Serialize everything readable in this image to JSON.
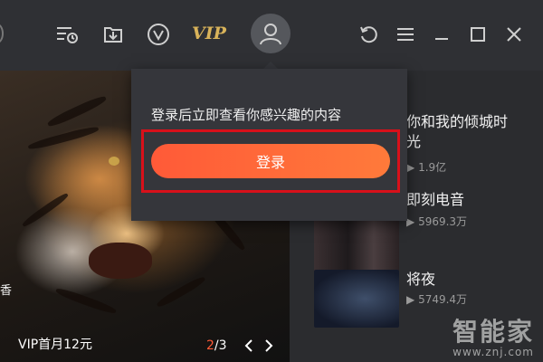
{
  "toolbar": {
    "vip_label": "VIP",
    "icons": [
      "watch-later-icon",
      "download-icon",
      "vip-circle-icon",
      "user-avatar-icon",
      "refresh-icon",
      "menu-icon",
      "minimize-icon",
      "maximize-icon",
      "close-icon"
    ]
  },
  "popup": {
    "message": "登录后立即查看你感兴趣的内容",
    "login_label": "登录"
  },
  "banner": {
    "caption": "VIP首月12元",
    "edge_text": "香",
    "page_current": "2",
    "page_total": "/3"
  },
  "list": {
    "items": [
      {
        "title": "你和我的倾城时光",
        "views": "1.9亿"
      },
      {
        "title": "即刻电音",
        "views": "5969.3万"
      },
      {
        "title": "将夜",
        "views": "5749.4万"
      }
    ]
  },
  "watermark": {
    "brand": "智能家",
    "url": "www.znj.com"
  },
  "colors": {
    "accent": "#ff5a38",
    "vip_gold": "#d9b35a",
    "highlight_red": "#d8101a",
    "background": "#2b2c2f"
  }
}
